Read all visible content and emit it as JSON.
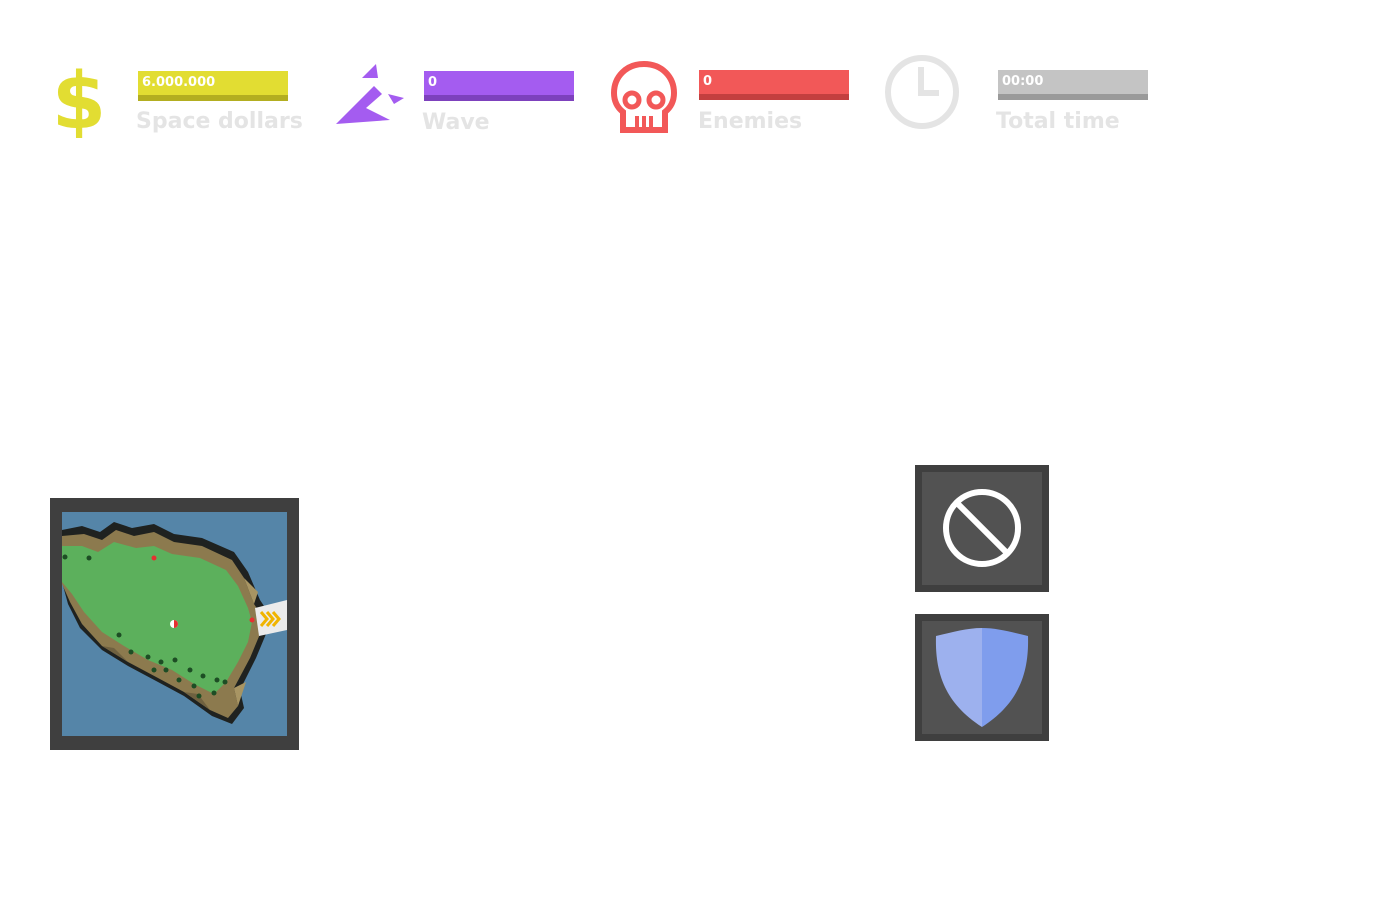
{
  "hud": {
    "money": {
      "icon": "dollar-icon",
      "value": "6.000.000",
      "label": "Space dollars",
      "color": "#e2dd32",
      "shade": "#b3ae20"
    },
    "wave": {
      "icon": "wave-shards-icon",
      "value": "0",
      "label": "Wave",
      "color": "#a45cf0",
      "shade": "#7d41bd"
    },
    "enemies": {
      "icon": "skull-icon",
      "value": "0",
      "label": "Enemies",
      "color": "#f25858",
      "shade": "#c33f3f"
    },
    "time": {
      "icon": "clock-icon",
      "value": "00:00",
      "label": "Total time",
      "color": "#c4c4c4",
      "shade": "#9a9a9a"
    }
  },
  "minimap": {
    "icon": "island-map",
    "water_color": "#5585a8",
    "grass_color": "#5cb05c",
    "cliff_color": "#8c7a4e",
    "spawn_marker_icon": "chevron-right-icon"
  },
  "actions": [
    {
      "name": "cancel-button",
      "icon": "prohibited-icon"
    },
    {
      "name": "shield-button",
      "icon": "shield-icon"
    }
  ]
}
